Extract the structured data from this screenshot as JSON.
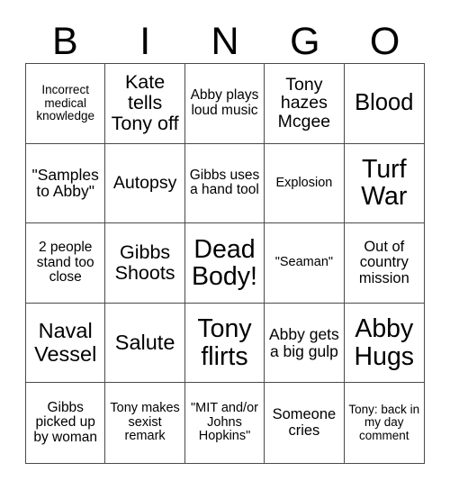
{
  "card": {
    "title": "BINGO",
    "header_letters": [
      "B",
      "I",
      "N",
      "G",
      "O"
    ],
    "columns": 5,
    "rows": 5,
    "text_color": "#000000",
    "border_color": "#4a4a4a",
    "background_color": "#ffffff"
  },
  "cells": [
    {
      "text": "Incorrect medical knowledge",
      "size": "fs-13",
      "column": "B",
      "row": 1
    },
    {
      "text": "Kate tells Tony off",
      "size": "fs-21",
      "column": "I",
      "row": 1
    },
    {
      "text": "Abby plays loud music",
      "size": "fs-15",
      "column": "N",
      "row": 1
    },
    {
      "text": "Tony hazes Mcgee",
      "size": "fs-19",
      "column": "G",
      "row": 1
    },
    {
      "text": "Blood",
      "size": "fs-25",
      "column": "O",
      "row": 1
    },
    {
      "text": "\"Samples to Abby\"",
      "size": "fs-17",
      "column": "B",
      "row": 2
    },
    {
      "text": "Autopsy",
      "size": "fs-19",
      "column": "I",
      "row": 2
    },
    {
      "text": "Gibbs uses a hand tool",
      "size": "fs-15",
      "column": "N",
      "row": 2
    },
    {
      "text": "Explosion",
      "size": "fs-14",
      "column": "G",
      "row": 2
    },
    {
      "text": "Turf War",
      "size": "fs-28",
      "column": "O",
      "row": 2
    },
    {
      "text": "2 people stand too close",
      "size": "fs-15",
      "column": "B",
      "row": 3
    },
    {
      "text": "Gibbs Shoots",
      "size": "fs-21",
      "column": "I",
      "row": 3
    },
    {
      "text": "Dead Body!",
      "size": "fs-28",
      "column": "N",
      "row": 3
    },
    {
      "text": "\"Seaman\"",
      "size": "fs-14",
      "column": "G",
      "row": 3
    },
    {
      "text": "Out of country mission",
      "size": "fs-16",
      "column": "O",
      "row": 3
    },
    {
      "text": "Naval Vessel",
      "size": "fs-23",
      "column": "B",
      "row": 4
    },
    {
      "text": "Salute",
      "size": "fs-23",
      "column": "I",
      "row": 4
    },
    {
      "text": "Tony flirts",
      "size": "fs-28",
      "column": "N",
      "row": 4
    },
    {
      "text": "Abby gets a big gulp",
      "size": "fs-17",
      "column": "G",
      "row": 4
    },
    {
      "text": "Abby Hugs",
      "size": "fs-28",
      "column": "O",
      "row": 4
    },
    {
      "text": "Gibbs picked up by woman",
      "size": "fs-15",
      "column": "B",
      "row": 5
    },
    {
      "text": "Tony makes sexist remark",
      "size": "fs-14",
      "column": "I",
      "row": 5
    },
    {
      "text": "\"MIT and/or Johns Hopkins\"",
      "size": "fs-14",
      "column": "N",
      "row": 5
    },
    {
      "text": "Someone cries",
      "size": "fs-16",
      "column": "G",
      "row": 5
    },
    {
      "text": "Tony: back in my day comment",
      "size": "fs-13",
      "column": "O",
      "row": 5
    }
  ]
}
